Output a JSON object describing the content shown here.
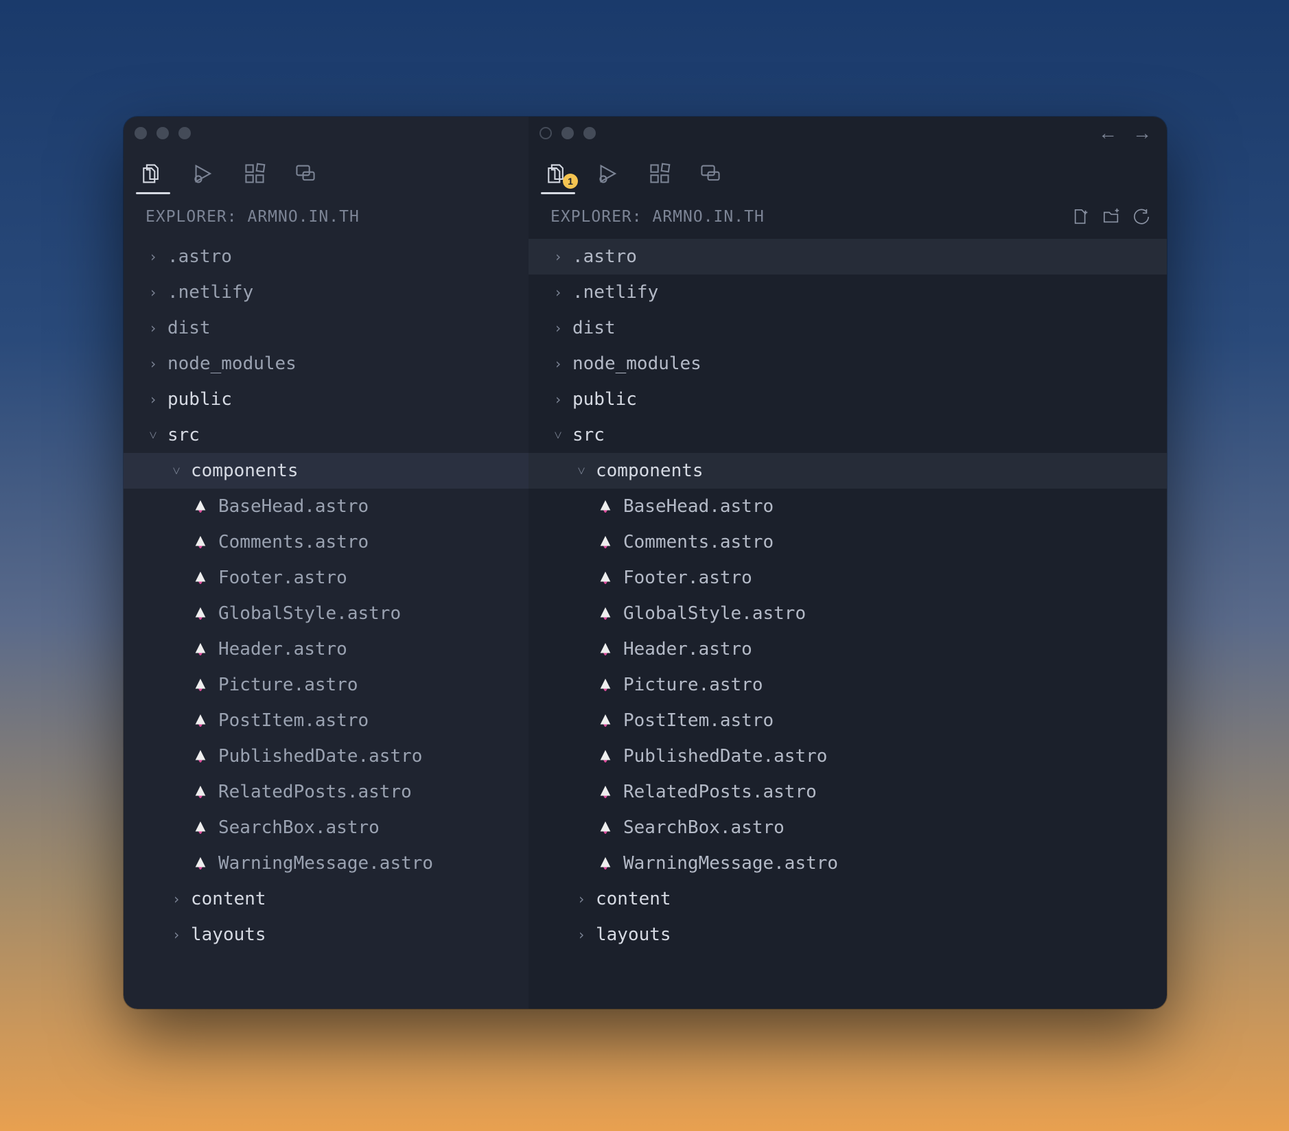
{
  "explorer_title": "EXPLORER: ARMNO.IN.TH",
  "activity_badge": "1",
  "panes": {
    "left": {
      "tree": [
        {
          "kind": "folder",
          "label": ".astro",
          "depth": 0,
          "expanded": false
        },
        {
          "kind": "folder",
          "label": ".netlify",
          "depth": 0,
          "expanded": false
        },
        {
          "kind": "folder",
          "label": "dist",
          "depth": 0,
          "expanded": false
        },
        {
          "kind": "folder",
          "label": "node_modules",
          "depth": 0,
          "expanded": false
        },
        {
          "kind": "folder",
          "label": "public",
          "depth": 0,
          "expanded": false,
          "bright": true
        },
        {
          "kind": "folder",
          "label": "src",
          "depth": 0,
          "expanded": true,
          "bright": true
        },
        {
          "kind": "folder",
          "label": "components",
          "depth": 1,
          "expanded": true,
          "bright": true,
          "highlight": true
        },
        {
          "kind": "file",
          "label": "BaseHead.astro",
          "depth": 2
        },
        {
          "kind": "file",
          "label": "Comments.astro",
          "depth": 2
        },
        {
          "kind": "file",
          "label": "Footer.astro",
          "depth": 2
        },
        {
          "kind": "file",
          "label": "GlobalStyle.astro",
          "depth": 2
        },
        {
          "kind": "file",
          "label": "Header.astro",
          "depth": 2
        },
        {
          "kind": "file",
          "label": "Picture.astro",
          "depth": 2
        },
        {
          "kind": "file",
          "label": "PostItem.astro",
          "depth": 2
        },
        {
          "kind": "file",
          "label": "PublishedDate.astro",
          "depth": 2
        },
        {
          "kind": "file",
          "label": "RelatedPosts.astro",
          "depth": 2
        },
        {
          "kind": "file",
          "label": "SearchBox.astro",
          "depth": 2
        },
        {
          "kind": "file",
          "label": "WarningMessage.astro",
          "depth": 2
        },
        {
          "kind": "folder",
          "label": "content",
          "depth": 1,
          "expanded": false,
          "bright": true
        },
        {
          "kind": "folder",
          "label": "layouts",
          "depth": 1,
          "expanded": false,
          "bright": true
        }
      ]
    },
    "right": {
      "tree": [
        {
          "kind": "folder",
          "label": ".astro",
          "depth": 0,
          "expanded": false,
          "highlight": true
        },
        {
          "kind": "folder",
          "label": ".netlify",
          "depth": 0,
          "expanded": false
        },
        {
          "kind": "folder",
          "label": "dist",
          "depth": 0,
          "expanded": false
        },
        {
          "kind": "folder",
          "label": "node_modules",
          "depth": 0,
          "expanded": false
        },
        {
          "kind": "folder",
          "label": "public",
          "depth": 0,
          "expanded": false,
          "bright": true
        },
        {
          "kind": "folder",
          "label": "src",
          "depth": 0,
          "expanded": true,
          "bright": true
        },
        {
          "kind": "folder",
          "label": "components",
          "depth": 1,
          "expanded": true,
          "bright": true,
          "highlight": true
        },
        {
          "kind": "file",
          "label": "BaseHead.astro",
          "depth": 2
        },
        {
          "kind": "file",
          "label": "Comments.astro",
          "depth": 2
        },
        {
          "kind": "file",
          "label": "Footer.astro",
          "depth": 2
        },
        {
          "kind": "file",
          "label": "GlobalStyle.astro",
          "depth": 2
        },
        {
          "kind": "file",
          "label": "Header.astro",
          "depth": 2
        },
        {
          "kind": "file",
          "label": "Picture.astro",
          "depth": 2
        },
        {
          "kind": "file",
          "label": "PostItem.astro",
          "depth": 2
        },
        {
          "kind": "file",
          "label": "PublishedDate.astro",
          "depth": 2
        },
        {
          "kind": "file",
          "label": "RelatedPosts.astro",
          "depth": 2
        },
        {
          "kind": "file",
          "label": "SearchBox.astro",
          "depth": 2
        },
        {
          "kind": "file",
          "label": "WarningMessage.astro",
          "depth": 2
        },
        {
          "kind": "folder",
          "label": "content",
          "depth": 1,
          "expanded": false,
          "bright": true
        },
        {
          "kind": "folder",
          "label": "layouts",
          "depth": 1,
          "expanded": false,
          "bright": true
        }
      ]
    }
  }
}
